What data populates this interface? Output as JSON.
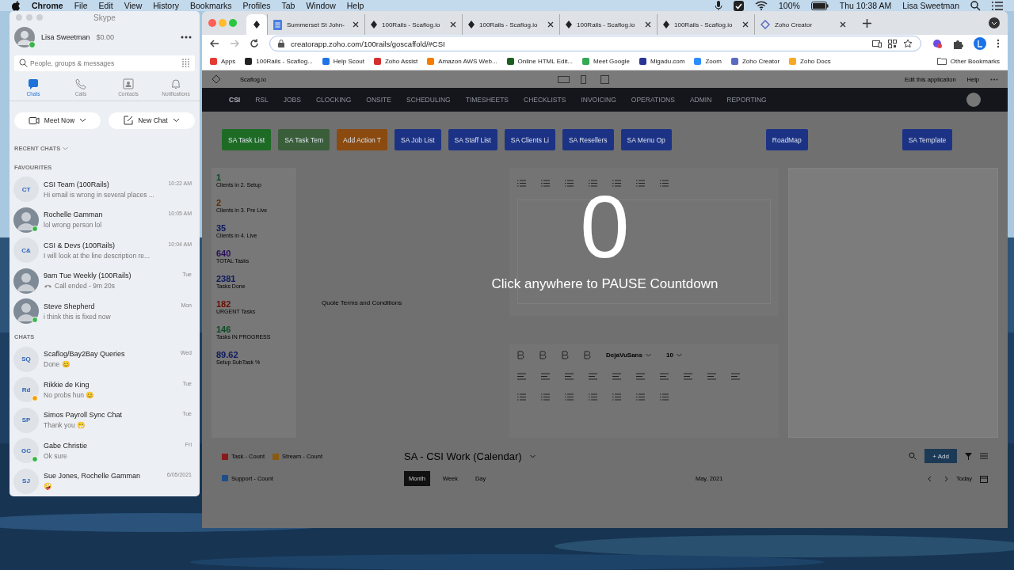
{
  "menubar": {
    "app": "Chrome",
    "menus": [
      "File",
      "Edit",
      "View",
      "History",
      "Bookmarks",
      "Profiles",
      "Tab",
      "Window",
      "Help"
    ],
    "battery": "100%",
    "clock": "Thu 10:38 AM",
    "user": "Lisa Sweetman"
  },
  "skype": {
    "title": "Skype",
    "profile": {
      "name": "Lisa Sweetman",
      "credit": "$0.00",
      "color": "#3cb44b"
    },
    "search": {
      "placeholder": "People, groups & messages"
    },
    "nav": [
      {
        "label": "Chats",
        "kind": "chats",
        "selected": true
      },
      {
        "label": "Calls",
        "kind": "calls",
        "selected": false
      },
      {
        "label": "Contacts",
        "kind": "contacts",
        "selected": false
      },
      {
        "label": "Notifications",
        "kind": "notifications",
        "selected": false
      }
    ],
    "buttons": [
      {
        "label": "Meet Now",
        "kind": "video"
      },
      {
        "label": "New Chat",
        "kind": "compose"
      }
    ],
    "recent_label": "RECENT CHATS",
    "sections": [
      {
        "title": "FAVOURITES",
        "chats": [
          {
            "photo": false,
            "initials": "CT",
            "name": "CSI Team (100Rails)",
            "time": "10:22 AM",
            "kind": "message",
            "message": "Hi email is wrong in several places ..."
          },
          {
            "photo": true,
            "name": "Rochelle Gamman",
            "time": "10:05 AM",
            "kind": "message",
            "message": "lol wrong person lol",
            "color": "#3cb44b"
          },
          {
            "photo": false,
            "initials": "C&",
            "name": "CSI & Devs (100Rails)",
            "time": "10:04 AM",
            "kind": "message",
            "message": "I will look at the line description re..."
          },
          {
            "photo": true,
            "name": "9am Tue Weekly (100Rails)",
            "time": "Tue",
            "kind": "call",
            "message": "Call ended - 9m 20s"
          },
          {
            "photo": true,
            "name": "Steve Shepherd",
            "time": "Mon",
            "kind": "message",
            "message": "i think this is fixed now",
            "color": "#3cb44b"
          }
        ]
      },
      {
        "title": "CHATS",
        "chats": [
          {
            "photo": false,
            "initials": "SQ",
            "name": "Scaflog/Bay2Bay Queries",
            "time": "Wed",
            "kind": "message",
            "message": "Done 😊"
          },
          {
            "photo": false,
            "initials": "Rd",
            "name": "Rikkie de King",
            "time": "Tue",
            "kind": "message",
            "message": "No probs hun 😊",
            "color": "#f0a30a"
          },
          {
            "photo": false,
            "initials": "SP",
            "name": "Simos Payroll Sync Chat",
            "time": "Tue",
            "kind": "message",
            "message": "Thank you 😁"
          },
          {
            "photo": false,
            "initials": "GC",
            "name": "Gabe Christie",
            "time": "Fri",
            "kind": "message",
            "message": "Ok sure",
            "color": "#3cb44b"
          },
          {
            "photo": false,
            "initials": "SJ",
            "name": "Sue Jones, Rochelle Gamman",
            "time": "6/05/2021",
            "kind": "message",
            "message": "🤪"
          }
        ]
      }
    ]
  },
  "browser": {
    "tabs": [
      {
        "kind": "app",
        "selected": true
      },
      {
        "title": "Summerset St John-",
        "selected": false,
        "kind": "doc"
      },
      {
        "title": "100Rails - Scaflog.io",
        "selected": false,
        "kind": "app"
      },
      {
        "title": "100Rails - Scaflog.io",
        "selected": false,
        "kind": "app"
      },
      {
        "title": "100Rails - Scaflog.io",
        "selected": false,
        "kind": "app"
      },
      {
        "title": "100Rails - Scaflog.io",
        "selected": false,
        "kind": "app"
      },
      {
        "title": "Zoho Creator",
        "selected": false,
        "kind": "zoho"
      }
    ],
    "url": "creatorapp.zoho.com/100rails/goscaffold/#CSI",
    "bookmarks": [
      {
        "label": "Apps",
        "color": "#e53935"
      },
      {
        "label": "100Rails - Scaflog...",
        "color": "#222222"
      },
      {
        "label": "Help Scout",
        "color": "#1f73e8"
      },
      {
        "label": "Zoho Assist",
        "color": "#d32f2f"
      },
      {
        "label": "Amazon AWS Web...",
        "color": "#f57c00"
      },
      {
        "label": "Online HTML Edit...",
        "color": "#1b5e20"
      },
      {
        "label": "Meet Google",
        "color": "#34a853"
      },
      {
        "label": "Migadu.com",
        "color": "#283593"
      },
      {
        "label": "Zoom",
        "color": "#2d8cff"
      },
      {
        "label": "Zoho Creator",
        "color": "#5c6bc0"
      },
      {
        "label": "Zoho Docs",
        "color": "#f9a825"
      }
    ],
    "other_bookmarks": "Other Bookmarks"
  },
  "app": {
    "title": "Scaflog.io",
    "edit_link": "Edit this application",
    "help": "Help",
    "nav": [
      {
        "label": "CSI",
        "selected": true
      },
      {
        "label": "RSL",
        "selected": false
      },
      {
        "label": "JOBS",
        "selected": false
      },
      {
        "label": "CLOCKING",
        "selected": false
      },
      {
        "label": "ONSITE",
        "selected": false
      },
      {
        "label": "SCHEDULING",
        "selected": false
      },
      {
        "label": "TIMESHEETS",
        "selected": false
      },
      {
        "label": "CHECKLISTS",
        "selected": false
      },
      {
        "label": "INVOICING",
        "selected": false
      },
      {
        "label": "OPERATIONS",
        "selected": false
      },
      {
        "label": "ADMIN",
        "selected": false
      },
      {
        "label": "REPORTING",
        "selected": false
      }
    ],
    "buttons": [
      {
        "label": "SA Task List",
        "color": "#1e6b26"
      },
      {
        "label": "SA Task Tem",
        "color": "#3a5e3a"
      },
      {
        "label": "Add Action T",
        "color": "#8a4a10"
      },
      {
        "label": "SA Job List",
        "color": "#1c3385"
      },
      {
        "label": "SA Staff List",
        "color": "#1c3385"
      },
      {
        "label": "SA Clients Li",
        "color": "#1c3385"
      },
      {
        "label": "SA Resellers",
        "color": "#1c3385"
      },
      {
        "label": "SA Menu Op",
        "color": "#1c3385"
      },
      {
        "label": "RoadMap",
        "color": "#1c3385"
      },
      {
        "label": "SA Template",
        "color": "#1c3385"
      }
    ],
    "stats": [
      {
        "value": "1",
        "label": "Clients in 2. Setup",
        "color": "#0b4a22"
      },
      {
        "value": "2",
        "label": "Clients in 3. Pre Live",
        "color": "#5a2e00"
      },
      {
        "value": "35",
        "label": "Clients in 4. Live",
        "color": "#0e1a5e"
      },
      {
        "value": "640",
        "label": "TOTAL Tasks",
        "color": "#2a0e5e"
      },
      {
        "value": "2381",
        "label": "Tasks Done",
        "color": "#0e1a5e"
      },
      {
        "value": "182",
        "label": "URGENT Tasks",
        "color": "#6a1004"
      },
      {
        "value": "146",
        "label": "Tasks IN PROGRESS",
        "color": "#0b4a22"
      },
      {
        "value": "89.62",
        "label": "Setup SubTask %",
        "color": "#0e1a5e"
      }
    ],
    "field_label": "Quote Terms and Conditions",
    "font": "DejaVuSans",
    "font_size": "10",
    "countdown": "0",
    "countdown_message": "Click anywhere to PAUSE Countdown",
    "legend": [
      {
        "label": "Task - Count",
        "color": "#8a1a1a"
      },
      {
        "label": "Stream - Count",
        "color": "#8a5a10"
      },
      {
        "label": "Support - Count",
        "color": "#1e4f8b"
      }
    ],
    "calendar": {
      "title": "SA - CSI Work (Calendar)",
      "add": "+ Add",
      "views": [
        {
          "label": "Month",
          "selected": true
        },
        {
          "label": "Week",
          "selected": false
        },
        {
          "label": "Day",
          "selected": false
        }
      ],
      "period": "May, 2021",
      "today": "Today"
    }
  }
}
